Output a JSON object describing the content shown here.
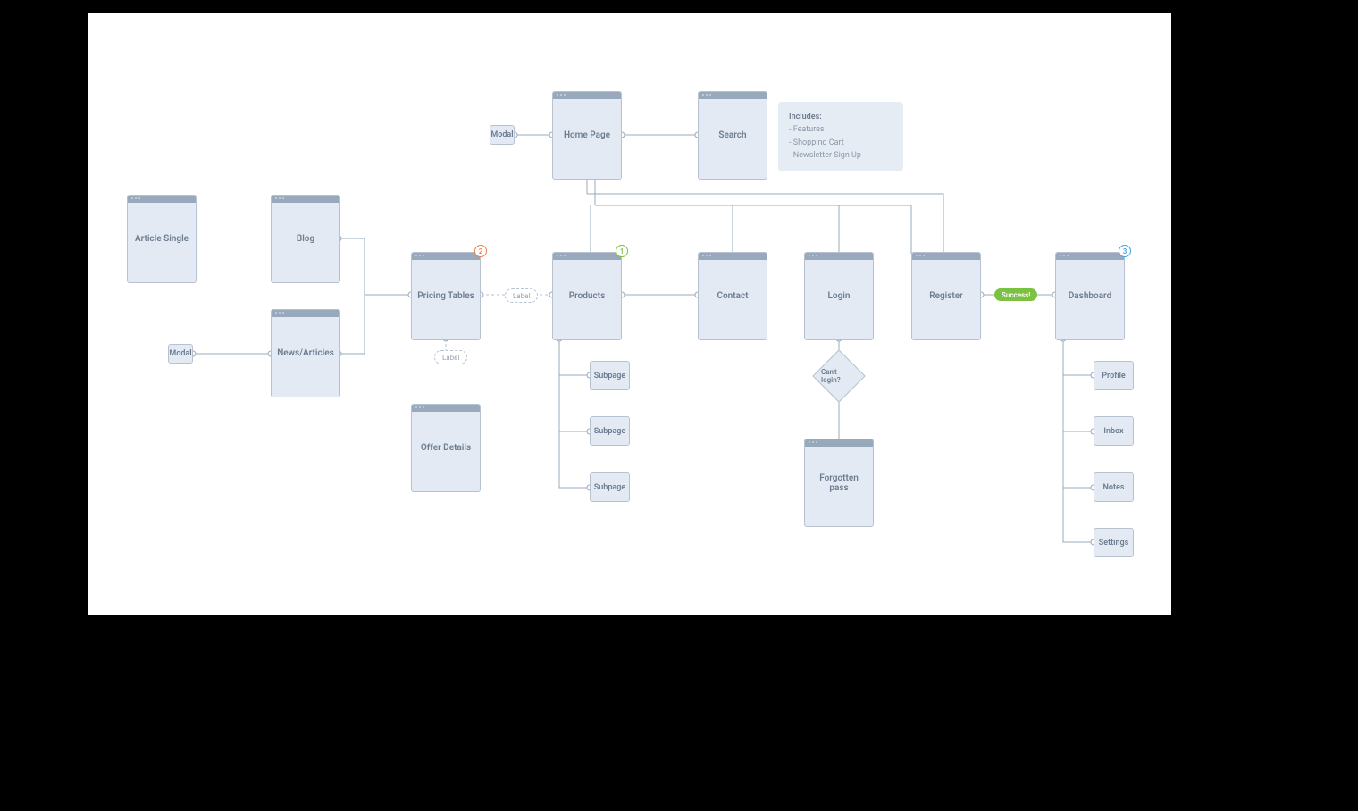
{
  "cards": {
    "home": "Home Page",
    "search": "Search",
    "article_single": "Article Single",
    "blog": "Blog",
    "news": "News/Articles",
    "pricing": "Pricing Tables",
    "offer": "Offer Details",
    "products": "Products",
    "contact": "Contact",
    "login": "Login",
    "register": "Register",
    "dashboard": "Dashboard",
    "forgotten": "Forgotten pass"
  },
  "small": {
    "modal_top": "Modal",
    "modal_left": "Modal",
    "sub1": "Subpage",
    "sub2": "Subpage",
    "sub3": "Subpage",
    "profile": "Profile",
    "inbox": "Inbox",
    "notes": "Notes",
    "settings": "Settings"
  },
  "note": {
    "title": "Includes:",
    "items": [
      "Features",
      "Shopping Cart",
      "Newsletter Sign Up"
    ]
  },
  "diamond": "Can't login?",
  "pill_success": "Success!",
  "dashed_label_hz": "Label",
  "dashed_label_v": "Label",
  "badges": {
    "pricing": "2",
    "products": "1",
    "dashboard": "3"
  }
}
